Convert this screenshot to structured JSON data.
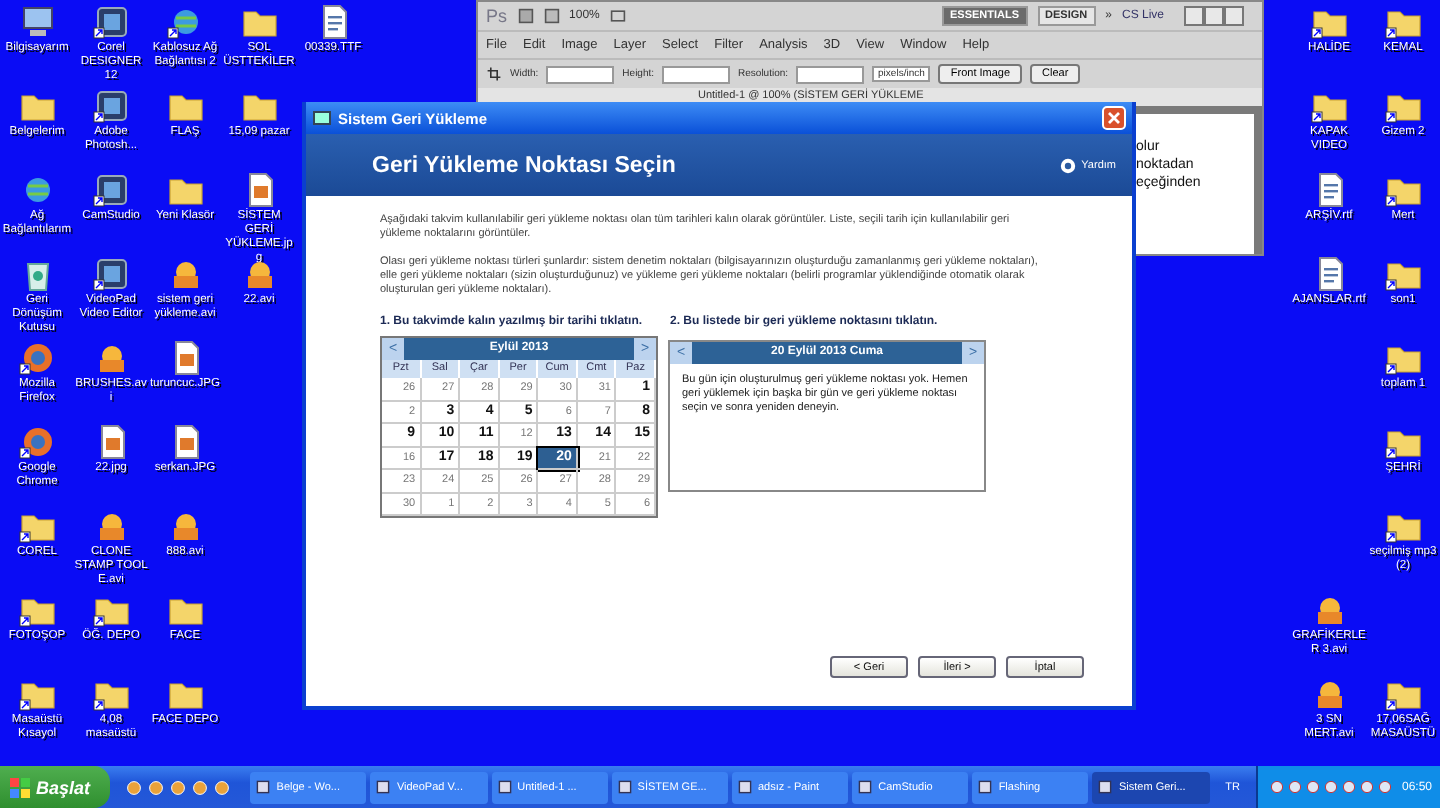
{
  "desktop": {
    "left_icons": [
      [
        {
          "label": "Bilgisayarım",
          "kind": "computer",
          "shortcut": false
        },
        {
          "label": "Corel DESIGNER 12",
          "kind": "app",
          "shortcut": true
        },
        {
          "label": "Kablosuz Ağ Bağlantısı 2",
          "kind": "network",
          "shortcut": true
        },
        {
          "label": "SOL ÜSTTEKİLER",
          "kind": "folder",
          "shortcut": false
        },
        {
          "label": "00339.TTF",
          "kind": "font",
          "shortcut": false
        }
      ],
      [
        {
          "label": "Belgelerim",
          "kind": "folder",
          "shortcut": false
        },
        {
          "label": "Adobe Photosh...",
          "kind": "app",
          "shortcut": true
        },
        {
          "label": "FLAŞ",
          "kind": "folder",
          "shortcut": false
        },
        {
          "label": "15,09 pazar",
          "kind": "folder",
          "shortcut": false
        }
      ],
      [
        {
          "label": "Ağ Bağlantılarım",
          "kind": "network",
          "shortcut": false
        },
        {
          "label": "CamStudio",
          "kind": "app",
          "shortcut": true
        },
        {
          "label": "Yeni Klasör",
          "kind": "folder",
          "shortcut": false
        },
        {
          "label": "SİSTEM GERİ YÜKLEME.jpg",
          "kind": "image",
          "shortcut": false
        }
      ],
      [
        {
          "label": "Geri Dönüşüm Kutusu",
          "kind": "recycle",
          "shortcut": false
        },
        {
          "label": "VideoPad Video Editor",
          "kind": "app",
          "shortcut": true
        },
        {
          "label": "sistem geri yükleme.avi",
          "kind": "video",
          "shortcut": false
        },
        {
          "label": "22.avi",
          "kind": "video",
          "shortcut": false
        }
      ],
      [
        {
          "label": "Mozilla Firefox",
          "kind": "browser",
          "shortcut": true
        },
        {
          "label": "BRUSHES.avi",
          "kind": "video",
          "shortcut": false
        },
        {
          "label": "turuncuc.JPG",
          "kind": "image",
          "shortcut": false
        }
      ],
      [
        {
          "label": "Google Chrome",
          "kind": "browser",
          "shortcut": true
        },
        {
          "label": "22.jpg",
          "kind": "image",
          "shortcut": false
        },
        {
          "label": "serkan.JPG",
          "kind": "image",
          "shortcut": false
        }
      ],
      [
        {
          "label": "COREL",
          "kind": "folder",
          "shortcut": true
        },
        {
          "label": "CLONE STAMP TOOL E.avi",
          "kind": "video",
          "shortcut": false
        },
        {
          "label": "888.avi",
          "kind": "video",
          "shortcut": false
        }
      ],
      [
        {
          "label": "FOTOŞOP",
          "kind": "folder",
          "shortcut": true
        },
        {
          "label": "ÖĞ. DEPO",
          "kind": "folder",
          "shortcut": true
        },
        {
          "label": "FACE",
          "kind": "folder",
          "shortcut": false
        }
      ],
      [
        {
          "label": "Masaüstü Kısayol",
          "kind": "folder",
          "shortcut": true
        },
        {
          "label": "4,08 masaüstü",
          "kind": "folder",
          "shortcut": true
        },
        {
          "label": "FACE DEPO",
          "kind": "folder",
          "shortcut": false
        }
      ]
    ],
    "right_icons": [
      {
        "left": {
          "label": "HALİDE",
          "kind": "folder",
          "shortcut": true
        },
        "right": {
          "label": "KEMAL",
          "kind": "folder",
          "shortcut": true
        }
      },
      {
        "left": {
          "label": "KAPAK VIDEO",
          "kind": "folder",
          "shortcut": true
        },
        "right": {
          "label": "Gizem 2",
          "kind": "folder",
          "shortcut": true
        }
      },
      {
        "left": {
          "label": "ARŞİV.rtf",
          "kind": "document",
          "shortcut": false
        },
        "right": {
          "label": "Mert",
          "kind": "folder",
          "shortcut": true
        }
      },
      {
        "left": {
          "label": "AJANSLAR.rtf",
          "kind": "document",
          "shortcut": false
        },
        "right": {
          "label": "son1",
          "kind": "folder",
          "shortcut": true
        }
      },
      {
        "right": {
          "label": "toplam 1",
          "kind": "folder",
          "shortcut": true
        }
      },
      {
        "right": {
          "label": "ŞEHRİ",
          "kind": "folder",
          "shortcut": true
        }
      },
      {
        "right": {
          "label": "seçilmiş mp3 (2)",
          "kind": "folder",
          "shortcut": true
        }
      },
      {
        "left": {
          "label": "GRAFİKERLER 3.avi",
          "kind": "video",
          "shortcut": false
        }
      },
      {
        "left": {
          "label": "3 SN MERT.avi",
          "kind": "video",
          "shortcut": false
        },
        "right": {
          "label": "17,06SAĞ MASAÜSTÜ",
          "kind": "folder",
          "shortcut": true
        }
      }
    ]
  },
  "photoshop": {
    "logo": "Ps",
    "zoom": "100%",
    "workspaces": [
      {
        "label": "ESSENTIALS",
        "selected": true
      },
      {
        "label": "DESIGN",
        "selected": false
      }
    ],
    "more": "»",
    "cs_live": "CS Live",
    "menu": [
      "File",
      "Edit",
      "Image",
      "Layer",
      "Select",
      "Filter",
      "Analysis",
      "3D",
      "View",
      "Window",
      "Help"
    ],
    "options": {
      "width_label": "Width:",
      "height_label": "Height:",
      "resolution_label": "Resolution:",
      "unit": "pixels/inch",
      "buttons": [
        "Front Image",
        "Clear"
      ]
    },
    "document_tab": "Untitled-1 @ 100% (SİSTEM GERİ YÜKLEME",
    "canvas_lines": [
      "olur",
      "noktadan",
      "eçeğinden"
    ]
  },
  "dialog": {
    "title": "Sistem Geri Yükleme",
    "heading": "Geri Yükleme Noktası Seçin",
    "help": "Yardım",
    "paragraphs": [
      "Aşağıdaki takvim kullanılabilir geri yükleme noktası olan tüm tarihleri kalın olarak görüntüler. Liste, seçili tarih için kullanılabilir geri yükleme noktalarını görüntüler.",
      "Olası geri yükleme noktası türleri şunlardır: sistem denetim noktaları (bilgisayarınızın oluşturduğu zamanlanmış geri yükleme noktaları), elle geri yükleme noktaları (sizin oluşturduğunuz) ve yükleme geri yükleme noktaları (belirli programlar yüklendiğinde otomatik olarak oluşturulan geri yükleme noktaları)."
    ],
    "step1": "1. Bu takvimde kalın yazılmış bir tarihi tıklatın.",
    "step2": "2. Bu listede bir geri yükleme noktasını tıklatın.",
    "calendar": {
      "prev": "<",
      "next": ">",
      "month": "Eylül 2013",
      "weekdays": [
        "Pzt",
        "Sal",
        "Çar",
        "Per",
        "Cum",
        "Cmt",
        "Paz"
      ],
      "weeks": [
        [
          {
            "day": "26",
            "bold": false,
            "selected": false
          },
          {
            "day": "27",
            "bold": false,
            "selected": false
          },
          {
            "day": "28",
            "bold": false,
            "selected": false
          },
          {
            "day": "29",
            "bold": false,
            "selected": false
          },
          {
            "day": "30",
            "bold": false,
            "selected": false
          },
          {
            "day": "31",
            "bold": false,
            "selected": false
          },
          {
            "day": "1",
            "bold": true,
            "selected": false
          }
        ],
        [
          {
            "day": "2",
            "bold": false,
            "selected": false
          },
          {
            "day": "3",
            "bold": true,
            "selected": false
          },
          {
            "day": "4",
            "bold": true,
            "selected": false
          },
          {
            "day": "5",
            "bold": true,
            "selected": false
          },
          {
            "day": "6",
            "bold": false,
            "selected": false
          },
          {
            "day": "7",
            "bold": false,
            "selected": false
          },
          {
            "day": "8",
            "bold": true,
            "selected": false
          }
        ],
        [
          {
            "day": "9",
            "bold": true,
            "selected": false
          },
          {
            "day": "10",
            "bold": true,
            "selected": false
          },
          {
            "day": "11",
            "bold": true,
            "selected": false
          },
          {
            "day": "12",
            "bold": false,
            "selected": false
          },
          {
            "day": "13",
            "bold": true,
            "selected": false
          },
          {
            "day": "14",
            "bold": true,
            "selected": false
          },
          {
            "day": "15",
            "bold": true,
            "selected": false
          }
        ],
        [
          {
            "day": "16",
            "bold": false,
            "selected": false
          },
          {
            "day": "17",
            "bold": true,
            "selected": false
          },
          {
            "day": "18",
            "bold": true,
            "selected": false
          },
          {
            "day": "19",
            "bold": true,
            "selected": false
          },
          {
            "day": "20",
            "bold": true,
            "selected": true
          },
          {
            "day": "21",
            "bold": false,
            "selected": false
          },
          {
            "day": "22",
            "bold": false,
            "selected": false
          }
        ],
        [
          {
            "day": "23",
            "bold": false,
            "selected": false
          },
          {
            "day": "24",
            "bold": false,
            "selected": false
          },
          {
            "day": "25",
            "bold": false,
            "selected": false
          },
          {
            "day": "26",
            "bold": false,
            "selected": false
          },
          {
            "day": "27",
            "bold": false,
            "selected": false
          },
          {
            "day": "28",
            "bold": false,
            "selected": false
          },
          {
            "day": "29",
            "bold": false,
            "selected": false
          }
        ],
        [
          {
            "day": "30",
            "bold": false,
            "selected": false
          },
          {
            "day": "1",
            "bold": false,
            "selected": false
          },
          {
            "day": "2",
            "bold": false,
            "selected": false
          },
          {
            "day": "3",
            "bold": false,
            "selected": false
          },
          {
            "day": "4",
            "bold": false,
            "selected": false
          },
          {
            "day": "5",
            "bold": false,
            "selected": false
          },
          {
            "day": "6",
            "bold": false,
            "selected": false
          }
        ]
      ]
    },
    "list": {
      "prev": "<",
      "next": ">",
      "date": "20 Eylül 2013 Cuma",
      "message": "Bu gün için oluşturulmuş geri yükleme noktası yok. Hemen geri yüklemek için başka bir gün ve geri yükleme noktası seçin ve sonra yeniden deneyin."
    },
    "buttons": [
      "< Geri",
      "İleri >",
      "İptal"
    ]
  },
  "taskbar": {
    "start": "Başlat",
    "tasks": [
      {
        "label": "Belge - Wo...",
        "selected": false
      },
      {
        "label": "VideoPad V...",
        "selected": false
      },
      {
        "label": "Untitled-1 ...",
        "selected": false
      },
      {
        "label": "SİSTEM GE...",
        "selected": false
      },
      {
        "label": "adsız - Paint",
        "selected": false
      },
      {
        "label": "CamStudio",
        "selected": false
      },
      {
        "label": "Flashing",
        "selected": false
      },
      {
        "label": "Sistem Geri...",
        "selected": true
      }
    ],
    "language": "TR",
    "clock": "06:50"
  }
}
